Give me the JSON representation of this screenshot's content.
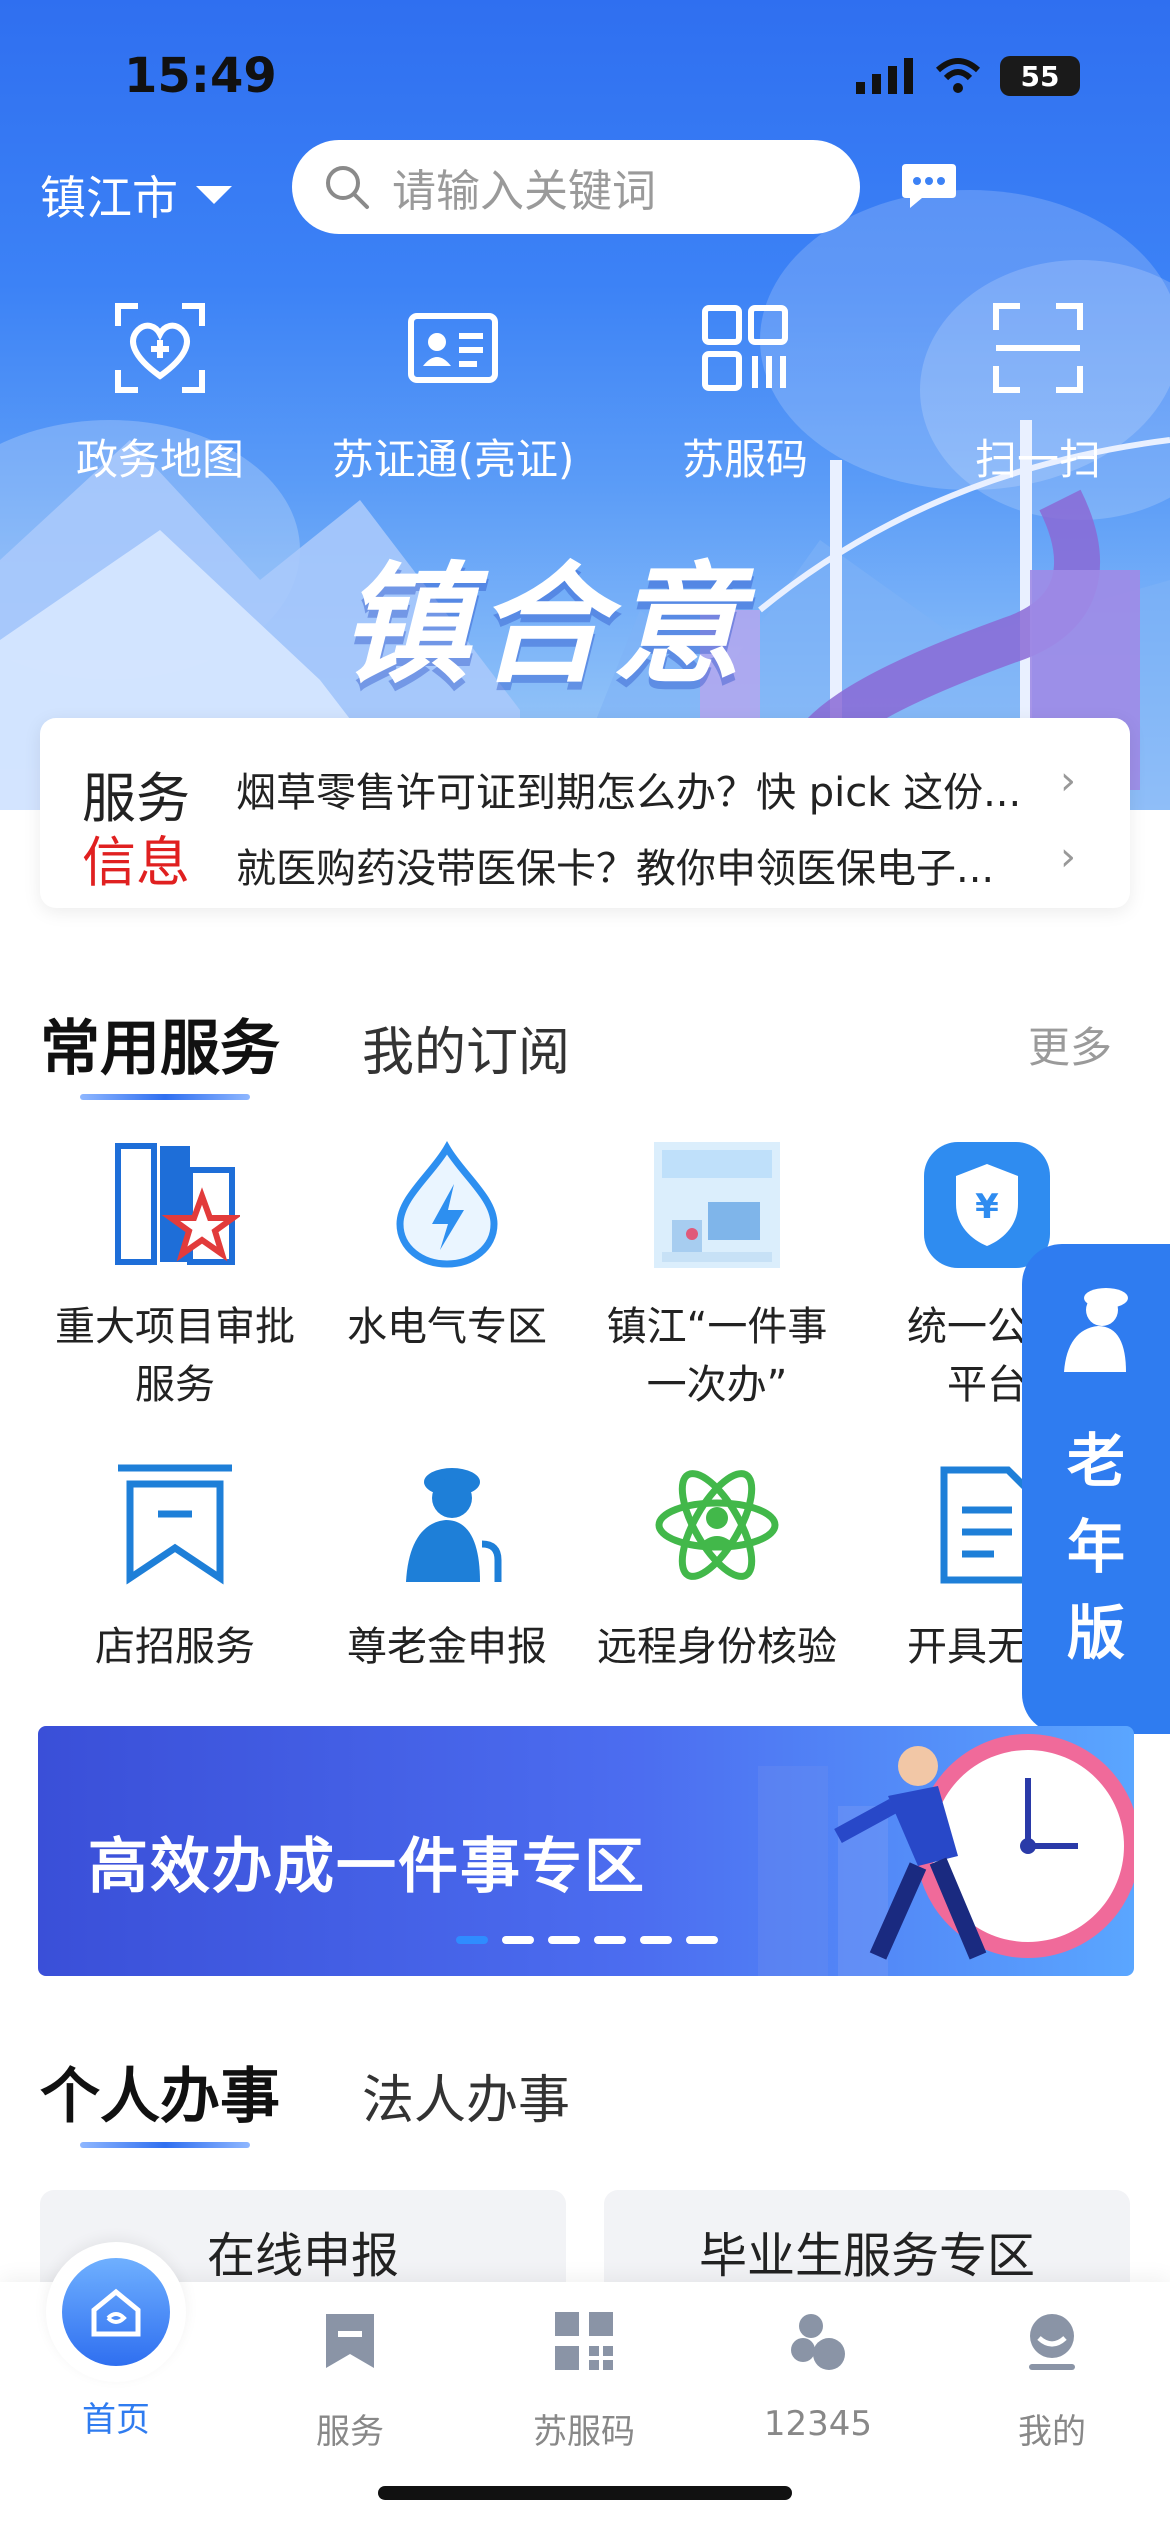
{
  "status": {
    "time": "15:49",
    "battery": "55"
  },
  "header": {
    "city": "镇江市",
    "search_placeholder": "请输入关键词"
  },
  "quick_actions": [
    {
      "label": "政务地图",
      "icon": "heart-location-icon"
    },
    {
      "label": "苏证通(亮证)",
      "icon": "id-card-icon"
    },
    {
      "label": "苏服码",
      "icon": "qr-code-icon"
    },
    {
      "label": "扫一扫",
      "icon": "scan-icon"
    }
  ],
  "hero": {
    "slogan": "镇合意"
  },
  "notice": {
    "title_line1": "服务",
    "title_line2": "信息",
    "items": [
      "烟草零售许可证到期怎么办？快 pick 这份...",
      "就医购药没带医保卡？教你申领医保电子..."
    ]
  },
  "services_section": {
    "tab_active": "常用服务",
    "tab_inactive": "我的订阅",
    "more": "更多",
    "items": [
      {
        "label": "重大项目审批\n服务",
        "icon": "building-star-icon"
      },
      {
        "label": "水电气专区",
        "icon": "utility-drop-icon"
      },
      {
        "label": "镇江“一件事\n一次办”",
        "icon": "one-thing-image"
      },
      {
        "label": "统一公共\n平台",
        "icon": "yuan-shield-icon"
      },
      {
        "label": "店招服务",
        "icon": "bookmark-icon"
      },
      {
        "label": "尊老金申报",
        "icon": "elder-icon"
      },
      {
        "label": "远程身份核验",
        "icon": "atom-person-icon"
      },
      {
        "label": "开具无房",
        "icon": "document-icon"
      }
    ]
  },
  "elder_mode": {
    "chars": [
      "老",
      "年",
      "版"
    ]
  },
  "banner": {
    "title": "高效办成一件事专区",
    "slide_count": 6,
    "active_slide": 0
  },
  "affairs_section": {
    "tab_active": "个人办事",
    "tab_inactive": "法人办事",
    "cards": [
      "在线申报",
      "毕业生服务专区"
    ]
  },
  "bottom_nav": {
    "items": [
      {
        "label": "首页",
        "icon": "home-icon",
        "active": true
      },
      {
        "label": "服务",
        "icon": "service-icon"
      },
      {
        "label": "苏服码",
        "icon": "qr-code-icon"
      },
      {
        "label": "12345",
        "icon": "hotline-icon"
      },
      {
        "label": "我的",
        "icon": "profile-icon"
      }
    ]
  },
  "colors": {
    "primary": "#2f6ff0",
    "accent_red": "#e02020",
    "nav_active": "#2f7cf0"
  }
}
